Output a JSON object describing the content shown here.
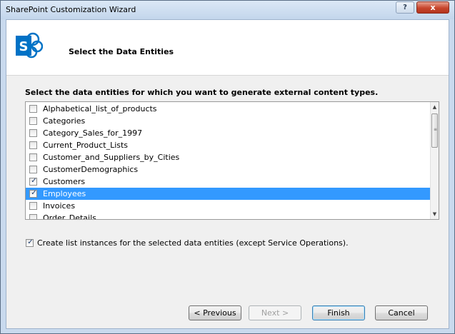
{
  "window": {
    "title": "SharePoint Customization Wizard",
    "help_label": "?",
    "close_label": "x"
  },
  "header": {
    "title": "Select the Data Entities",
    "logo_letter": "S"
  },
  "content": {
    "instructions": "Select the data entities for which you want to generate external content types.",
    "entities": [
      {
        "label": "Alphabetical_list_of_products",
        "checked": false,
        "selected": false
      },
      {
        "label": "Categories",
        "checked": false,
        "selected": false
      },
      {
        "label": "Category_Sales_for_1997",
        "checked": false,
        "selected": false
      },
      {
        "label": "Current_Product_Lists",
        "checked": false,
        "selected": false
      },
      {
        "label": "Customer_and_Suppliers_by_Cities",
        "checked": false,
        "selected": false
      },
      {
        "label": "CustomerDemographics",
        "checked": false,
        "selected": false
      },
      {
        "label": "Customers",
        "checked": true,
        "selected": false
      },
      {
        "label": "Employees",
        "checked": true,
        "selected": true
      },
      {
        "label": "Invoices",
        "checked": false,
        "selected": false
      },
      {
        "label": "Order_Details",
        "checked": false,
        "selected": false
      }
    ],
    "create_list_option": {
      "label": "Create list instances for the selected data entities (except Service Operations).",
      "checked": true
    }
  },
  "buttons": {
    "previous": "< Previous",
    "next": "Next >",
    "finish": "Finish",
    "cancel": "Cancel"
  },
  "colors": {
    "selection": "#3399ff",
    "sharepoint_blue": "#0072c6",
    "dialog_background": "#f0f0f0"
  }
}
